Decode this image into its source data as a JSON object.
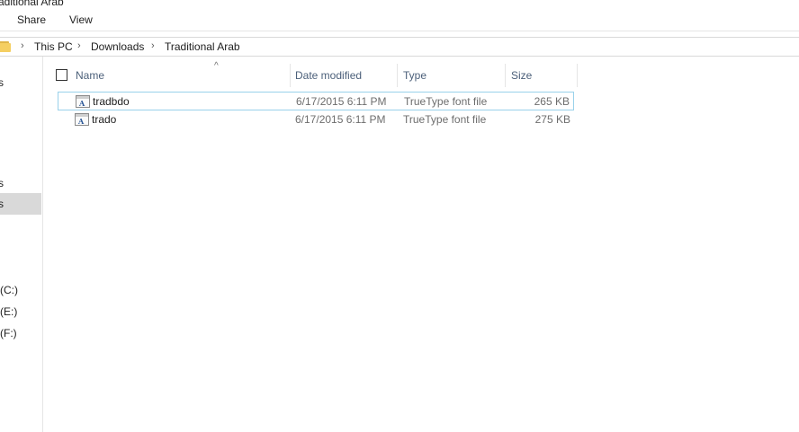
{
  "window": {
    "title": "raditional Arab"
  },
  "ribbon": {
    "tabs": [
      "Share",
      "View"
    ]
  },
  "address": {
    "breadcrumbs": [
      "This PC",
      "Downloads",
      "Traditional Arab"
    ],
    "separator": "›",
    "folder_icon": "folder-icon"
  },
  "navpane": {
    "items": [
      {
        "label": "s",
        "selected": false
      },
      {
        "label": "s",
        "selected": false
      },
      {
        "label": "s",
        "selected": true
      },
      {
        "label": "(C:)",
        "selected": false
      },
      {
        "label": "(E:)",
        "selected": false
      },
      {
        "label": "(F:)",
        "selected": false
      }
    ]
  },
  "columns": {
    "name": "Name",
    "date_modified": "Date modified",
    "type": "Type",
    "size": "Size",
    "sort_indicator": "^"
  },
  "files": [
    {
      "name": "tradbdo",
      "date_modified": "6/17/2015 6:11 PM",
      "type": "TrueType font file",
      "size": "265 KB",
      "focused": true,
      "icon": "font-file-icon"
    },
    {
      "name": "trado",
      "date_modified": "6/17/2015 6:11 PM",
      "type": "TrueType font file",
      "size": "275 KB",
      "focused": false,
      "icon": "font-file-icon"
    }
  ],
  "colors": {
    "accent_border": "#99d1ea",
    "selected_nav": "#d9d9d9",
    "header_text": "#4c607a"
  }
}
